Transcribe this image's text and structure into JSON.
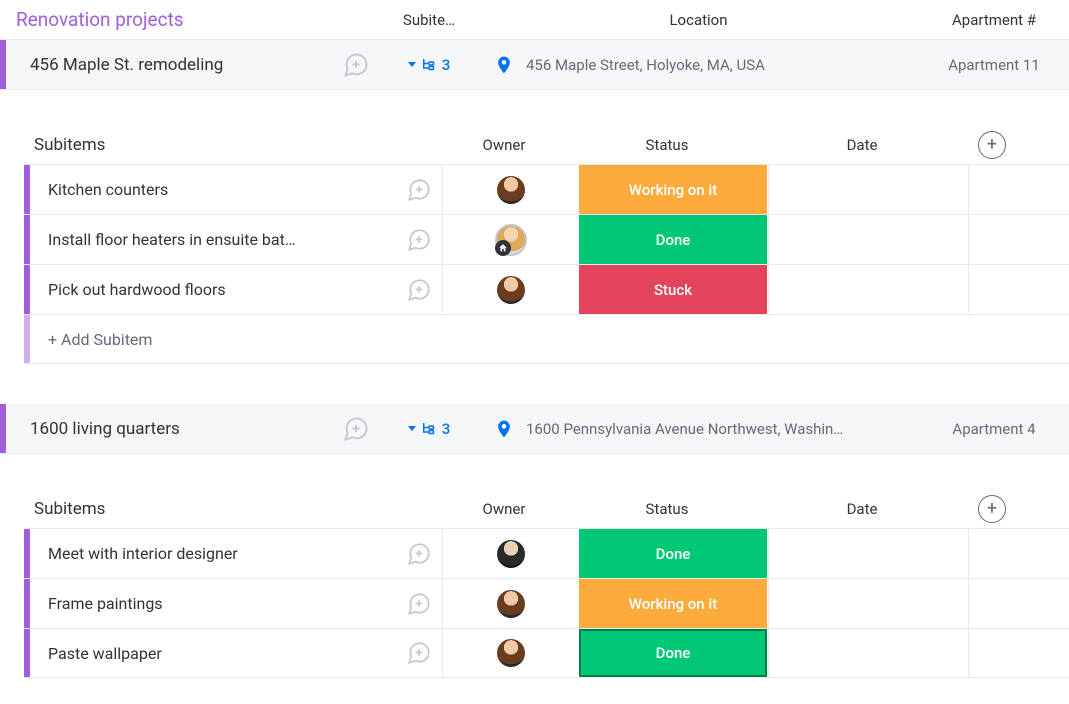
{
  "group": {
    "title": "Renovation projects",
    "columns": {
      "subitems": "Subite…",
      "location": "Location",
      "apartment": "Apartment #"
    }
  },
  "sub_columns": {
    "name": "Subitems",
    "owner": "Owner",
    "status": "Status",
    "date": "Date"
  },
  "add_subitem_label": "+ Add Subitem",
  "status_labels": {
    "working": "Working on it",
    "done": "Done",
    "stuck": "Stuck"
  },
  "projects": [
    {
      "name": "456 Maple St. remodeling",
      "subitem_count": "3",
      "location": "456 Maple Street, Holyoke, MA, USA",
      "apartment": "Apartment 11",
      "subitems": [
        {
          "name": "Kitchen counters",
          "owner": "a1",
          "status": "working"
        },
        {
          "name": "Install floor heaters in ensuite bat…",
          "owner": "a2",
          "owner_badge": true,
          "status": "done"
        },
        {
          "name": "Pick out hardwood floors",
          "owner": "a1",
          "status": "stuck"
        }
      ],
      "show_add": true
    },
    {
      "name": "1600 living quarters",
      "subitem_count": "3",
      "location": "1600 Pennsylvania Avenue Northwest, Washin…",
      "apartment": "Apartment 4",
      "subitems": [
        {
          "name": "Meet with interior designer",
          "owner": "a3",
          "status": "done"
        },
        {
          "name": "Frame paintings",
          "owner": "a1",
          "status": "working"
        },
        {
          "name": "Paste wallpaper",
          "owner": "a1",
          "status": "done",
          "outlined": true
        }
      ],
      "show_add": false
    }
  ]
}
